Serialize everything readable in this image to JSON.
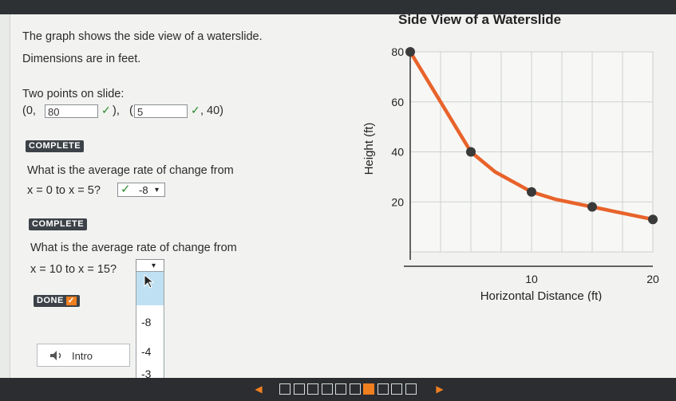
{
  "problem": {
    "line1": "The graph shows the side view of a waterslide.",
    "line2": "Dimensions are in feet.",
    "points_label": "Two points on slide:",
    "point1_prefix": "(0,",
    "point1_value": "80",
    "point1_suffix": "),",
    "point2_prefix": "(",
    "point2_value": "5",
    "point2_suffix": ", 40)",
    "complete_badge_1": "COMPLETE",
    "q1_line1": "What is the average rate of change from",
    "q1_line2": "x = 0 to x = 5?",
    "q1_answer": "-8",
    "complete_badge_2": "COMPLETE",
    "q2_line1": "What is the average rate of change from",
    "q2_line2": "x = 10 to x = 15?",
    "done_badge": "DONE",
    "dropdown_options": [
      "-8",
      "-4",
      "-3"
    ],
    "intro_label": "Intro"
  },
  "chart_data": {
    "type": "line",
    "title": "Side View of a Waterslide",
    "xlabel": "Horizontal  Distance (ft)",
    "ylabel": "Height (ft)",
    "xlim": [
      0,
      20
    ],
    "ylim": [
      0,
      80
    ],
    "x_ticks": [
      "10",
      "20"
    ],
    "y_ticks": [
      "20",
      "40",
      "60",
      "80"
    ],
    "grid": true,
    "series": [
      {
        "color": "#e8632b",
        "x": [
          0,
          2,
          4,
          5,
          7,
          10,
          12,
          15,
          17,
          20
        ],
        "y": [
          80,
          64,
          48,
          40,
          32,
          24,
          21,
          18,
          16,
          13
        ]
      }
    ],
    "marked_points": {
      "x": [
        0,
        5,
        10,
        15,
        20
      ],
      "y": [
        80,
        40,
        24,
        18,
        13
      ],
      "color": "#3a3a3a"
    }
  },
  "pager": {
    "pages": 10,
    "active_index": 6
  }
}
